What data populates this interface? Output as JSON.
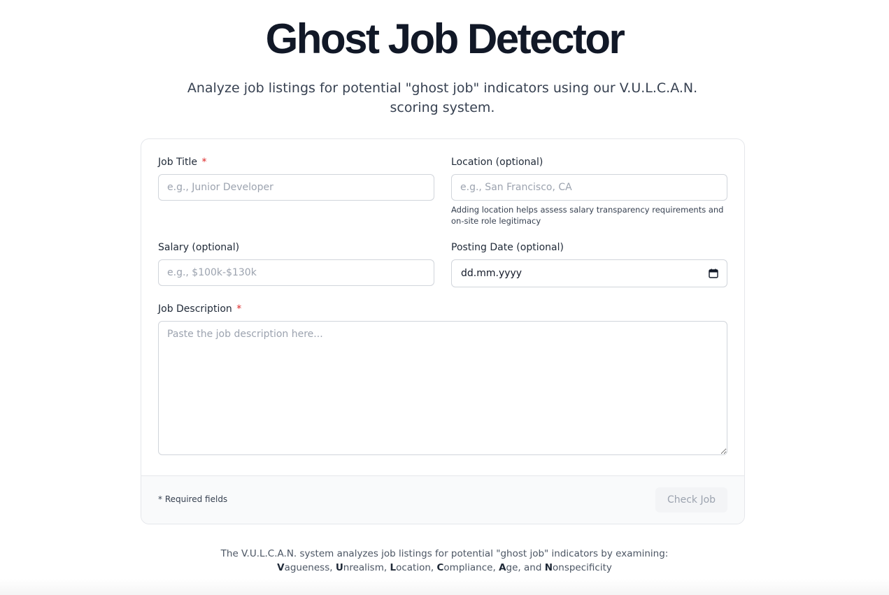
{
  "header": {
    "title": "Ghost Job Detector",
    "subtitle": "Analyze job listings for potential \"ghost job\" indicators using our V.U.L.C.A.N. scoring system."
  },
  "form": {
    "job_title": {
      "label": "Job Title",
      "required_mark": "*",
      "placeholder": "e.g., Junior Developer",
      "value": ""
    },
    "location": {
      "label": "Location (optional)",
      "placeholder": "e.g., San Francisco, CA",
      "value": "",
      "help": "Adding location helps assess salary transparency requirements and on-site role legitimacy"
    },
    "salary": {
      "label": "Salary (optional)",
      "placeholder": "e.g., $100k-$130k",
      "value": ""
    },
    "posting_date": {
      "label": "Posting Date (optional)",
      "value": "dd.mm.yyyy",
      "icon": "calendar-icon"
    },
    "description": {
      "label": "Job Description",
      "required_mark": "*",
      "placeholder": "Paste the job description here...",
      "value": ""
    }
  },
  "footer": {
    "required_note": "* Required fields",
    "submit_label": "Check Job"
  },
  "info": {
    "line1": "The V.U.L.C.A.N. system analyzes job listings for potential \"ghost job\" indicators by examining:",
    "terms": [
      {
        "initial": "V",
        "rest": "agueness"
      },
      {
        "initial": "U",
        "rest": "nrealism"
      },
      {
        "initial": "L",
        "rest": "ocation"
      },
      {
        "initial": "C",
        "rest": "ompliance"
      },
      {
        "initial": "A",
        "rest": "ge"
      },
      {
        "initial": "N",
        "rest": "onspecificity"
      }
    ],
    "sep": ", ",
    "and": "and "
  },
  "colors": {
    "required": "#dc2626",
    "button_disabled_bg": "#f3f4f6",
    "button_disabled_text": "#9ca3af"
  }
}
